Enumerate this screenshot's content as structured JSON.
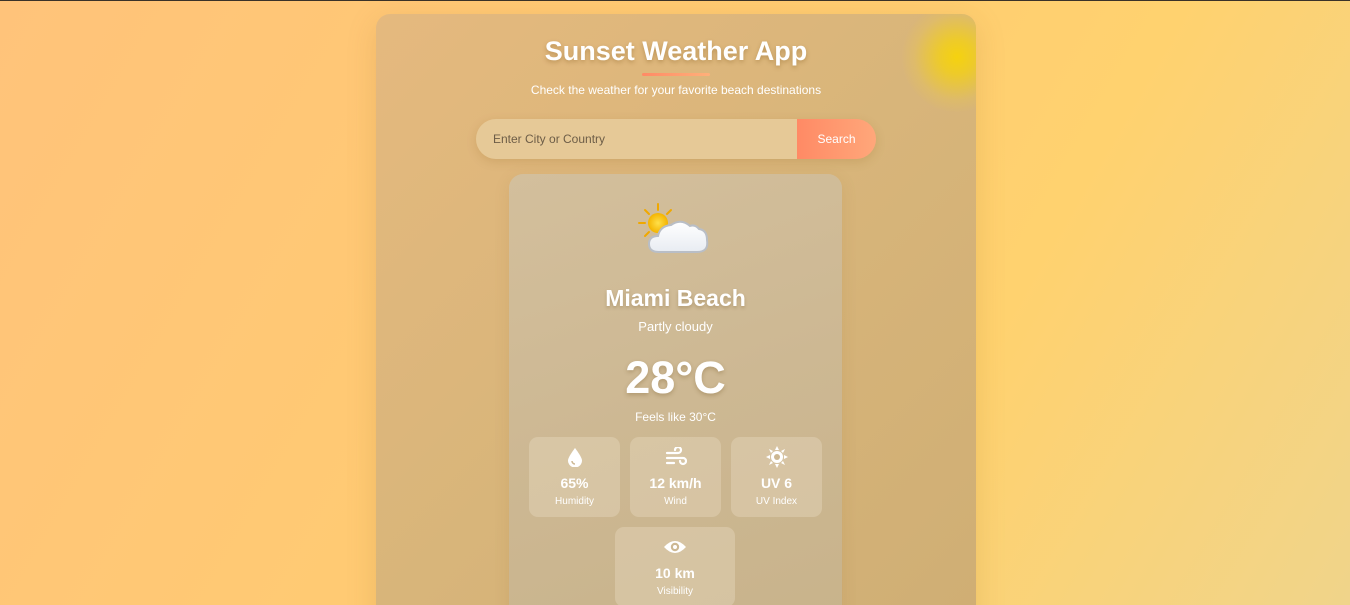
{
  "app": {
    "title": "Sunset Weather App",
    "subtitle": "Check the weather for your favorite beach destinations"
  },
  "search": {
    "placeholder": "Enter City or Country",
    "value": "",
    "button_label": "Search"
  },
  "weather": {
    "icon": "partly-cloudy-icon",
    "city": "Miami Beach",
    "condition": "Partly cloudy",
    "temperature": "28°C",
    "feels_like": "Feels like 30°C",
    "stats": [
      {
        "icon": "water-drop-icon",
        "value": "65%",
        "label": "Humidity"
      },
      {
        "icon": "wind-icon",
        "value": "12 km/h",
        "label": "Wind"
      },
      {
        "icon": "sun-icon",
        "value": "UV 6",
        "label": "UV Index"
      },
      {
        "icon": "eye-icon",
        "value": "10 km",
        "label": "Visibility"
      }
    ]
  },
  "colors": {
    "accent": "#ff8a65",
    "sun": "#f5d20f",
    "background": "#ffc977"
  }
}
